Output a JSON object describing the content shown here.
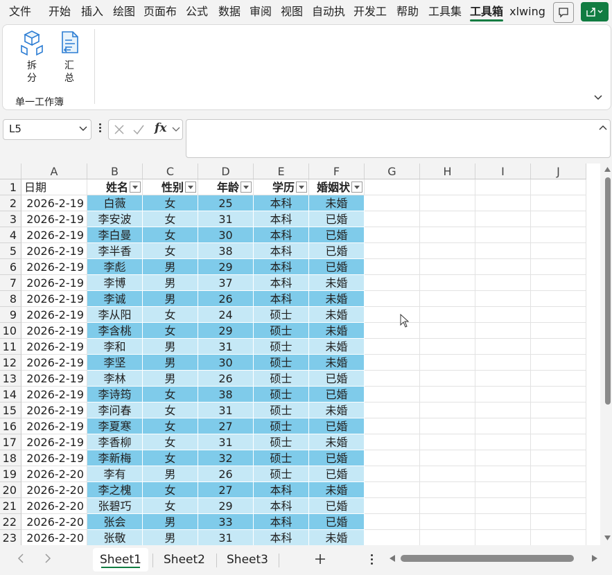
{
  "ribbon_tabs": [
    "文件",
    "开始",
    "插入",
    "绘图",
    "页面布",
    "公式",
    "数据",
    "审阅",
    "视图",
    "自动执",
    "开发工",
    "帮助",
    "工具集",
    "工具箱",
    "xlwing"
  ],
  "active_tab_index": 13,
  "ribbon": {
    "buttons": [
      {
        "label1": "拆",
        "label2": "分",
        "icon": "split-cube-icon"
      },
      {
        "label1": "汇",
        "label2": "总",
        "icon": "merge-document-icon"
      }
    ],
    "group_label": "单一工作簿"
  },
  "name_box": {
    "value": "L5"
  },
  "fx_label": "fx",
  "formula_bar": {
    "value": ""
  },
  "column_headers": [
    "A",
    "B",
    "C",
    "D",
    "E",
    "F",
    "G",
    "H",
    "I",
    "J"
  ],
  "table": {
    "date_header": "日期",
    "headers": [
      "姓名",
      "性别",
      "年龄",
      "学历",
      "婚姻状"
    ],
    "rows": [
      {
        "row": "2",
        "date": "2026-2-19",
        "name": "白薇",
        "gender": "女",
        "age": "25",
        "edu": "本科",
        "marital": "未婚"
      },
      {
        "row": "3",
        "date": "2026-2-19",
        "name": "李安波",
        "gender": "女",
        "age": "31",
        "edu": "本科",
        "marital": "已婚"
      },
      {
        "row": "4",
        "date": "2026-2-19",
        "name": "李白曼",
        "gender": "女",
        "age": "30",
        "edu": "本科",
        "marital": "已婚"
      },
      {
        "row": "5",
        "date": "2026-2-19",
        "name": "李半香",
        "gender": "女",
        "age": "38",
        "edu": "本科",
        "marital": "已婚"
      },
      {
        "row": "6",
        "date": "2026-2-19",
        "name": "李彪",
        "gender": "男",
        "age": "29",
        "edu": "本科",
        "marital": "已婚"
      },
      {
        "row": "7",
        "date": "2026-2-19",
        "name": "李博",
        "gender": "男",
        "age": "37",
        "edu": "本科",
        "marital": "未婚"
      },
      {
        "row": "8",
        "date": "2026-2-19",
        "name": "李诚",
        "gender": "男",
        "age": "26",
        "edu": "本科",
        "marital": "未婚"
      },
      {
        "row": "9",
        "date": "2026-2-19",
        "name": "李从阳",
        "gender": "女",
        "age": "24",
        "edu": "硕士",
        "marital": "未婚"
      },
      {
        "row": "10",
        "date": "2026-2-19",
        "name": "李含桃",
        "gender": "女",
        "age": "29",
        "edu": "硕士",
        "marital": "未婚"
      },
      {
        "row": "11",
        "date": "2026-2-19",
        "name": "李和",
        "gender": "男",
        "age": "31",
        "edu": "硕士",
        "marital": "未婚"
      },
      {
        "row": "12",
        "date": "2026-2-19",
        "name": "李坚",
        "gender": "男",
        "age": "30",
        "edu": "硕士",
        "marital": "未婚"
      },
      {
        "row": "13",
        "date": "2026-2-19",
        "name": "李林",
        "gender": "男",
        "age": "26",
        "edu": "硕士",
        "marital": "已婚"
      },
      {
        "row": "14",
        "date": "2026-2-19",
        "name": "李诗筠",
        "gender": "女",
        "age": "38",
        "edu": "硕士",
        "marital": "已婚"
      },
      {
        "row": "15",
        "date": "2026-2-19",
        "name": "李问春",
        "gender": "女",
        "age": "31",
        "edu": "硕士",
        "marital": "未婚"
      },
      {
        "row": "16",
        "date": "2026-2-19",
        "name": "李夏寒",
        "gender": "女",
        "age": "27",
        "edu": "硕士",
        "marital": "已婚"
      },
      {
        "row": "17",
        "date": "2026-2-19",
        "name": "李香柳",
        "gender": "女",
        "age": "31",
        "edu": "硕士",
        "marital": "未婚"
      },
      {
        "row": "18",
        "date": "2026-2-19",
        "name": "李新梅",
        "gender": "女",
        "age": "32",
        "edu": "硕士",
        "marital": "已婚"
      },
      {
        "row": "19",
        "date": "2026-2-20",
        "name": "李有",
        "gender": "男",
        "age": "26",
        "edu": "硕士",
        "marital": "已婚"
      },
      {
        "row": "20",
        "date": "2026-2-20",
        "name": "李之槐",
        "gender": "女",
        "age": "27",
        "edu": "本科",
        "marital": "未婚"
      },
      {
        "row": "21",
        "date": "2026-2-20",
        "name": "张碧巧",
        "gender": "女",
        "age": "29",
        "edu": "本科",
        "marital": "已婚"
      },
      {
        "row": "22",
        "date": "2026-2-20",
        "name": "张会",
        "gender": "男",
        "age": "33",
        "edu": "本科",
        "marital": "已婚"
      },
      {
        "row": "23",
        "date": "2026-2-20",
        "name": "张敬",
        "gender": "男",
        "age": "31",
        "edu": "本科",
        "marital": "未婚"
      }
    ]
  },
  "sheets": [
    "Sheet1",
    "Sheet2",
    "Sheet3"
  ],
  "active_sheet_index": 0,
  "colors": {
    "accent": "#107c41",
    "band_dark": "#7fcbea",
    "band_light": "#c5e8f6"
  }
}
